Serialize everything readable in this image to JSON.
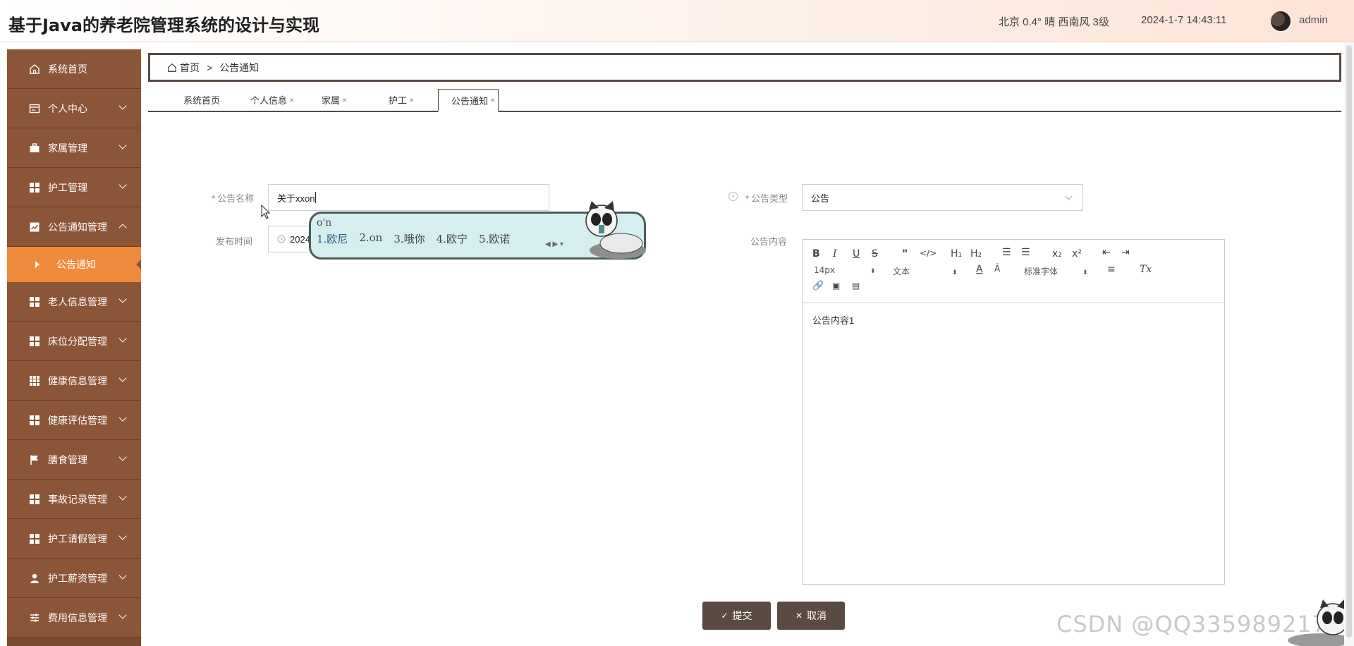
{
  "header": {
    "title": "基于Java的养老院管理系统的设计与实现",
    "weather": "北京  0.4°  晴  西南风  3级",
    "datetime": "2024-1-7 14:43:11",
    "username": "admin"
  },
  "sidebar": {
    "items": [
      {
        "label": "系统首页",
        "icon": "home-icon"
      },
      {
        "label": "个人中心",
        "icon": "card-icon"
      },
      {
        "label": "家属管理",
        "icon": "briefcase-icon"
      },
      {
        "label": "护工管理",
        "icon": "grid-icon"
      },
      {
        "label": "公告通知管理",
        "icon": "chart-icon",
        "expanded": true
      },
      {
        "label": "公告通知",
        "sub": true,
        "active": true
      },
      {
        "label": "老人信息管理",
        "icon": "grid-icon"
      },
      {
        "label": "床位分配管理",
        "icon": "grid-icon"
      },
      {
        "label": "健康信息管理",
        "icon": "grid9-icon"
      },
      {
        "label": "健康评估管理",
        "icon": "grid-icon"
      },
      {
        "label": "膳食管理",
        "icon": "flag-icon"
      },
      {
        "label": "事故记录管理",
        "icon": "grid-icon"
      },
      {
        "label": "护工请假管理",
        "icon": "grid-icon"
      },
      {
        "label": "护工薪资管理",
        "icon": "user-icon"
      },
      {
        "label": "费用信息管理",
        "icon": "sliders-icon"
      }
    ]
  },
  "breadcrumb": {
    "home": "首页",
    "separator": ">",
    "current": "公告通知"
  },
  "tabs": [
    {
      "label": "系统首页",
      "closable": false
    },
    {
      "label": "个人信息",
      "closable": true
    },
    {
      "label": "家属",
      "closable": true
    },
    {
      "label": "护工",
      "closable": true
    },
    {
      "label": "公告通知",
      "closable": true,
      "active": true
    }
  ],
  "tab_close": "×",
  "form": {
    "title_label": "公告名称",
    "title_value": "关于xxon",
    "type_label": "公告类型",
    "type_value": "公告",
    "time_label": "发布时间",
    "time_value": "2024",
    "content_label": "公告内容",
    "required_mark": "*"
  },
  "editor": {
    "font_size": "14px",
    "block_type": "文本",
    "font_family": "标准字体",
    "content": "公告内容1"
  },
  "buttons": {
    "submit": "提交",
    "cancel": "取消"
  },
  "ime": {
    "pinyin": "o'n",
    "candidates": [
      "1.欧尼",
      "2.on",
      "3.哦你",
      "4.欧宁",
      "5.欧诺"
    ]
  },
  "watermark": "CSDN @QQ3359892174",
  "colors": {
    "sidebar": "#8b5537",
    "active_menu": "#f08a3c",
    "button": "#5a4a42",
    "border_dark": "#5a4a42"
  }
}
